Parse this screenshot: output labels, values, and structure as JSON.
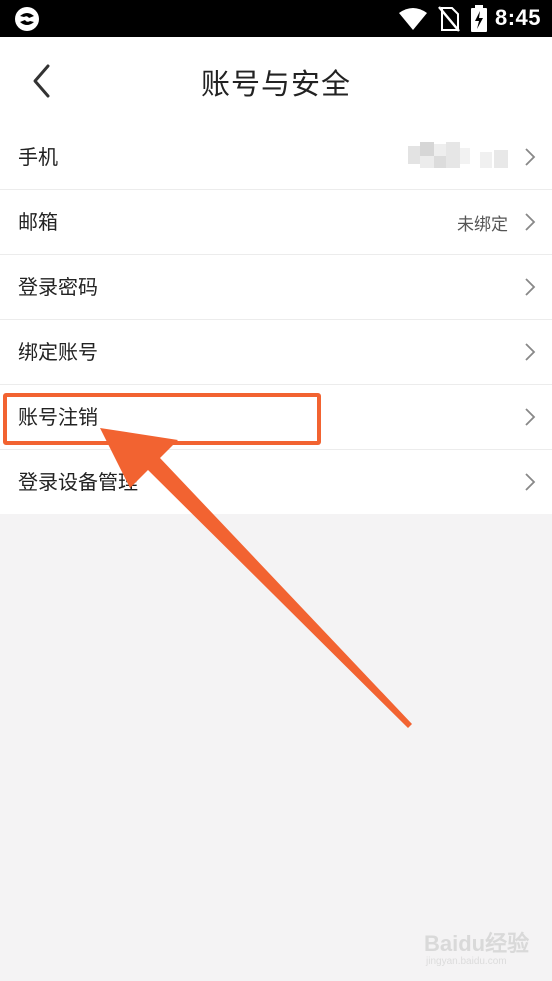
{
  "status_bar": {
    "time": "8:45",
    "icons": [
      "app-logo-icon",
      "wifi-icon",
      "no-sim-icon",
      "battery-charging-icon"
    ]
  },
  "header": {
    "title": "账号与安全",
    "back_icon": "chevron-left-icon"
  },
  "settings": {
    "items": [
      {
        "label": "手机",
        "value": "",
        "value_redacted": true
      },
      {
        "label": "邮箱",
        "value": "未绑定"
      },
      {
        "label": "登录密码",
        "value": ""
      },
      {
        "label": "绑定账号",
        "value": ""
      },
      {
        "label": "账号注销",
        "value": "",
        "highlighted": true
      },
      {
        "label": "登录设备管理",
        "value": ""
      }
    ]
  },
  "annotation": {
    "highlight_color": "#f26331",
    "arrow_color": "#f26331",
    "target": "账号注销"
  },
  "watermark": {
    "brand": "Baidu经验",
    "url": "jingyan.baidu.com"
  }
}
